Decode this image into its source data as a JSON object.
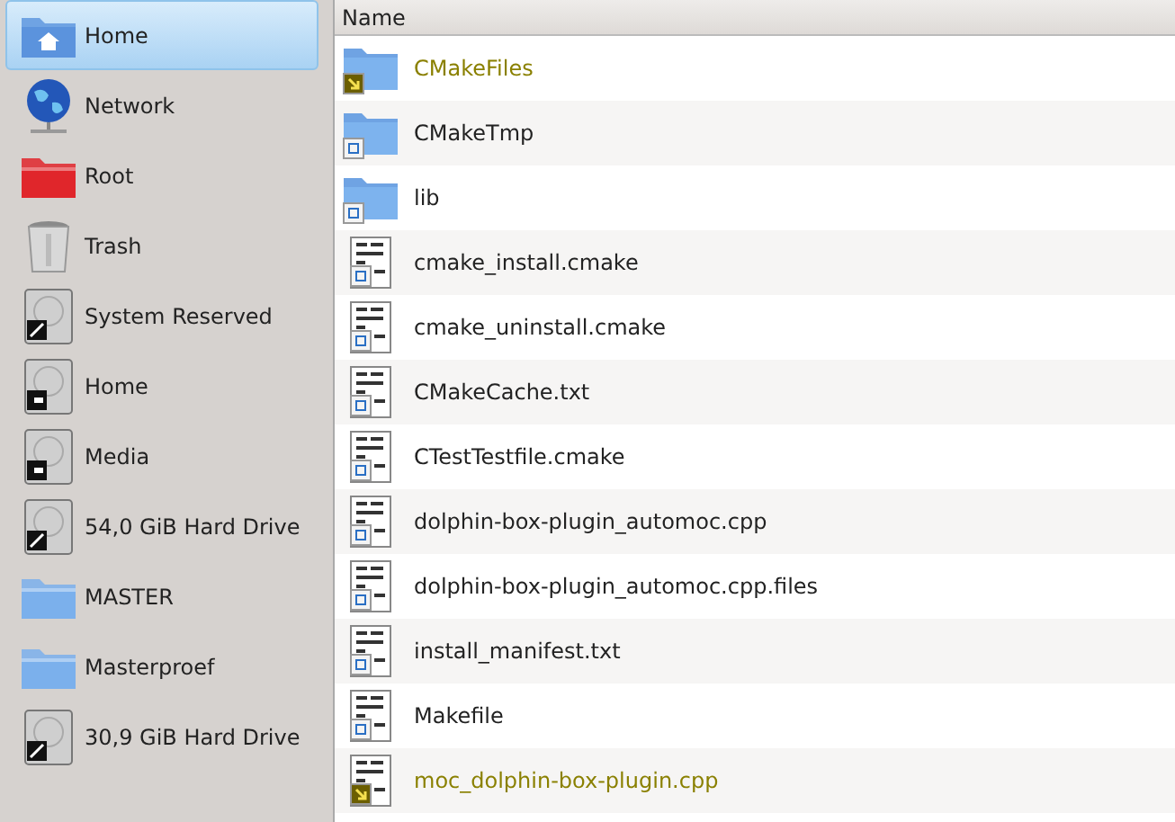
{
  "sidebar": {
    "items": [
      {
        "label": "Home",
        "kind": "home",
        "selected": true
      },
      {
        "label": "Network",
        "kind": "network",
        "selected": false
      },
      {
        "label": "Root",
        "kind": "red-folder",
        "selected": false
      },
      {
        "label": "Trash",
        "kind": "trash",
        "selected": false
      },
      {
        "label": "System Reserved",
        "kind": "drive",
        "selected": false
      },
      {
        "label": "Home",
        "kind": "usb-drive",
        "selected": false
      },
      {
        "label": "Media",
        "kind": "usb-drive",
        "selected": false
      },
      {
        "label": "54,0 GiB Hard Drive",
        "kind": "drive",
        "selected": false
      },
      {
        "label": "MASTER",
        "kind": "folder",
        "selected": false
      },
      {
        "label": "Masterproef",
        "kind": "folder",
        "selected": false
      },
      {
        "label": "30,9 GiB Hard Drive",
        "kind": "drive",
        "selected": false
      }
    ]
  },
  "file_list": {
    "columns": [
      "Name"
    ],
    "rows": [
      {
        "name": "CMakeFiles",
        "kind": "folder",
        "modified": true
      },
      {
        "name": "CMakeTmp",
        "kind": "folder",
        "modified": false
      },
      {
        "name": "lib",
        "kind": "folder",
        "modified": false
      },
      {
        "name": "cmake_install.cmake",
        "kind": "file",
        "modified": false
      },
      {
        "name": "cmake_uninstall.cmake",
        "kind": "file",
        "modified": false
      },
      {
        "name": "CMakeCache.txt",
        "kind": "file",
        "modified": false
      },
      {
        "name": "CTestTestfile.cmake",
        "kind": "file",
        "modified": false
      },
      {
        "name": "dolphin-box-plugin_automoc.cpp",
        "kind": "file",
        "modified": false
      },
      {
        "name": "dolphin-box-plugin_automoc.cpp.files",
        "kind": "file",
        "modified": false
      },
      {
        "name": "install_manifest.txt",
        "kind": "file",
        "modified": false
      },
      {
        "name": "Makefile",
        "kind": "file",
        "modified": false
      },
      {
        "name": "moc_dolphin-box-plugin.cpp",
        "kind": "file",
        "modified": true
      }
    ]
  }
}
